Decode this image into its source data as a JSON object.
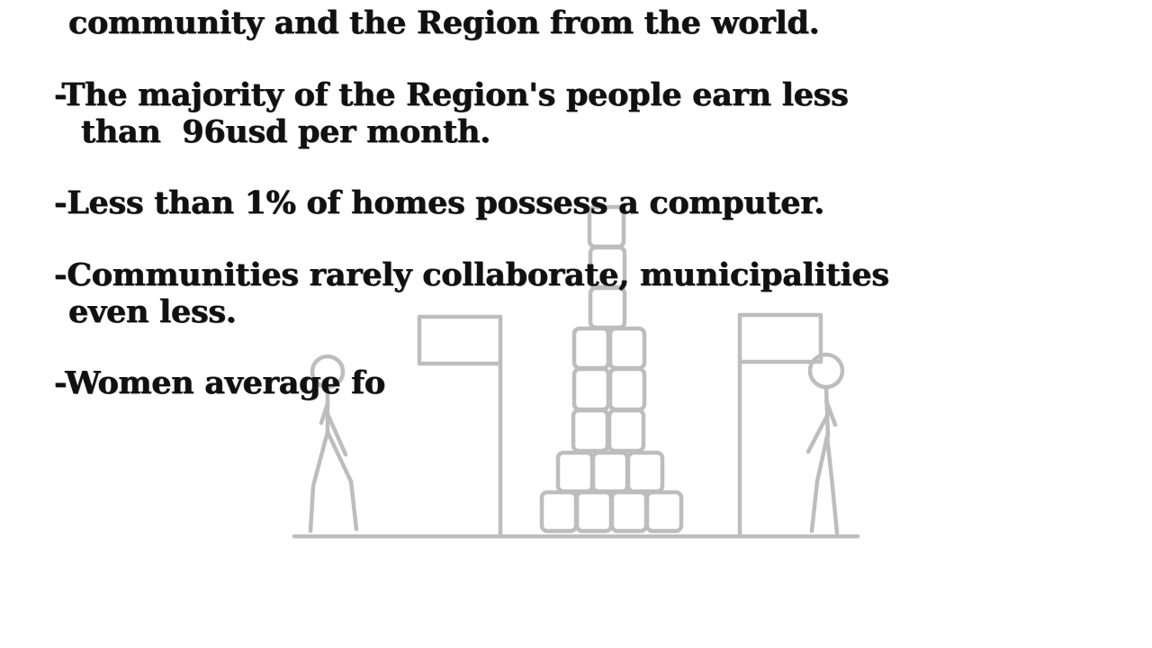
{
  "text_lines": [
    "community and the Region from the world.",
    "-The majority of the Region's people earn less",
    "than  96usd per month.",
    "-Less than 1% of homes possess a computer.",
    "-Communities rarely collaborate, municipalities",
    "even less.",
    "-Women average fo"
  ],
  "colors": {
    "background": "#ffffff",
    "text": "#111111",
    "drawing_stroke": "#bdbdbd"
  },
  "drawing": {
    "description_icons": [
      "stick-figure-icon",
      "flag-icon",
      "stone-tower-icon",
      "stick-figure-icon",
      "flag-icon"
    ]
  }
}
